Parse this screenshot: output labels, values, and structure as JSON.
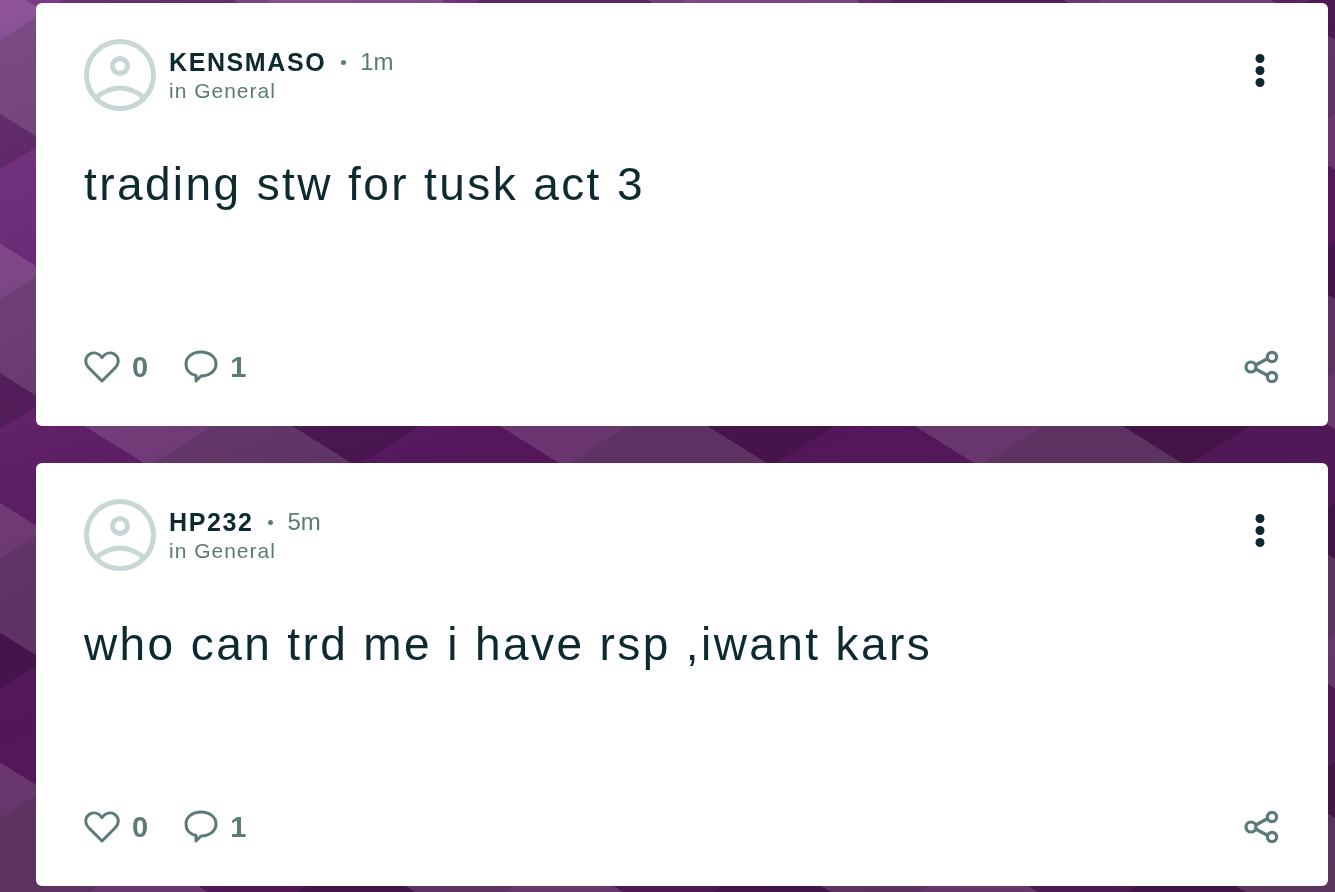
{
  "posts": [
    {
      "author": "KENSMASO",
      "time": "1m",
      "category": "in General",
      "body": "trading stw for tusk act 3",
      "likes": "0",
      "comments": "1"
    },
    {
      "author": "HP232",
      "time": "5m",
      "category": "in General",
      "body": "who can trd me i have rsp ,iwant kars",
      "likes": "0",
      "comments": "1"
    }
  ]
}
